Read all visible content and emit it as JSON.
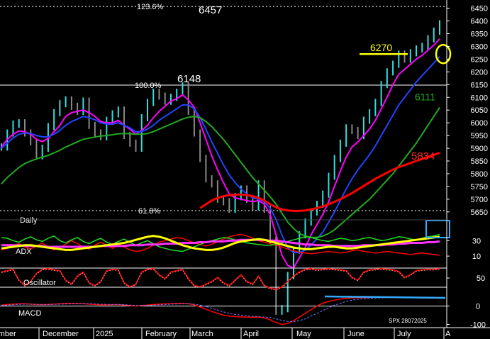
{
  "chart_data": {
    "type": "line",
    "symbol_code": "SPX 28072025",
    "timeframe_label": "Daily",
    "months": [
      "November",
      "December",
      "2025",
      "February",
      "March",
      "April",
      "May",
      "June",
      "July",
      "A"
    ],
    "price_panel": {
      "ylim": [
        5630,
        6460
      ],
      "y_ticks": [
        5650,
        5700,
        5750,
        5800,
        5850,
        5900,
        5950,
        6000,
        6050,
        6100,
        6150,
        6200,
        6250,
        6300,
        6350,
        6400,
        6450
      ],
      "annotations": [
        {
          "label": "6457",
          "value": 6457,
          "color": "#ffffff"
        },
        {
          "label": "6148",
          "value": 6148,
          "color": "#ffffff"
        },
        {
          "label": "6270",
          "value": 6270,
          "color": "#ffff00"
        },
        {
          "label": "6111",
          "value": 6111,
          "color": "#22aa22"
        },
        {
          "label": "5834",
          "value": 5834,
          "color": "#ff2222"
        }
      ],
      "fib_levels": [
        {
          "label": "123.6%",
          "value": 6457
        },
        {
          "label": "100.0%",
          "value": 6148
        },
        {
          "label": "61.8%",
          "value": 5655
        }
      ],
      "close": [
        5905,
        5960,
        5995,
        6000,
        5960,
        5925,
        5870,
        5900,
        5985,
        6040,
        6075,
        6090,
        6065,
        6045,
        6085,
        5990,
        5960,
        5945,
        6010,
        6035,
        6050,
        5950,
        5920,
        5900,
        6020,
        6080,
        6120,
        6105,
        6085,
        6100,
        6120,
        6145,
        6045,
        5960,
        5860,
        5780,
        5760,
        5700,
        5690,
        5660,
        5710,
        5740,
        5700,
        5670,
        5760,
        5660,
        5540,
        5260,
        5270,
        5400,
        5500,
        5560,
        5610,
        5650,
        5680,
        5720,
        5790,
        5860,
        5920,
        5980,
        5970,
        5950,
        6010,
        6040,
        6080,
        6150,
        6200,
        6230,
        6270,
        6250,
        6275,
        6290,
        6300,
        6330,
        6360,
        6389
      ],
      "series": [
        {
          "name": "",
          "color": "#ff00ff",
          "values": [
            5905,
            5935,
            5955,
            5968,
            5965,
            5955,
            5935,
            5926,
            5938,
            5965,
            5990,
            6025,
            6040,
            6045,
            6050,
            6040,
            6025,
            6005,
            6000,
            6000,
            6010,
            5990,
            5975,
            5955,
            5970,
            5990,
            6020,
            6045,
            6065,
            6085,
            6095,
            6110,
            6090,
            6060,
            6000,
            5935,
            5870,
            5815,
            5765,
            5720,
            5705,
            5700,
            5695,
            5690,
            5695,
            5680,
            5640,
            5560,
            5480,
            5440,
            5430,
            5470,
            5510,
            5560,
            5600,
            5640,
            5690,
            5750,
            5810,
            5865,
            5905,
            5925,
            5950,
            5975,
            6010,
            6055,
            6100,
            6150,
            6190,
            6210,
            6230,
            6250,
            6265,
            6285,
            6305,
            6330
          ]
        },
        {
          "name": "",
          "color": "#2244ff",
          "values": [
            5900,
            5920,
            5940,
            5955,
            5960,
            5958,
            5950,
            5945,
            5945,
            5955,
            5970,
            5990,
            6005,
            6015,
            6025,
            6020,
            6012,
            6000,
            5995,
            5995,
            6000,
            5990,
            5980,
            5965,
            5965,
            5975,
            5990,
            6010,
            6025,
            6040,
            6055,
            6070,
            6070,
            6055,
            6020,
            5975,
            5925,
            5880,
            5835,
            5795,
            5765,
            5740,
            5720,
            5705,
            5700,
            5690,
            5665,
            5620,
            5560,
            5510,
            5490,
            5490,
            5500,
            5520,
            5545,
            5570,
            5610,
            5650,
            5695,
            5740,
            5780,
            5815,
            5845,
            5875,
            5910,
            5950,
            5990,
            6030,
            6070,
            6100,
            6130,
            6160,
            6185,
            6210,
            6235,
            6260
          ]
        },
        {
          "name": "",
          "color": "#22aa22",
          "values": [
            5760,
            5785,
            5805,
            5825,
            5840,
            5850,
            5858,
            5865,
            5872,
            5882,
            5892,
            5905,
            5915,
            5925,
            5935,
            5940,
            5944,
            5948,
            5950,
            5953,
            5957,
            5958,
            5957,
            5955,
            5955,
            5958,
            5965,
            5975,
            5985,
            5995,
            6005,
            6015,
            6022,
            6025,
            6020,
            6005,
            5985,
            5960,
            5935,
            5905,
            5875,
            5845,
            5815,
            5785,
            5760,
            5735,
            5710,
            5680,
            5645,
            5610,
            5585,
            5565,
            5555,
            5550,
            5550,
            5555,
            5565,
            5580,
            5600,
            5620,
            5640,
            5660,
            5680,
            5700,
            5725,
            5750,
            5775,
            5800,
            5830,
            5860,
            5890,
            5920,
            5955,
            5990,
            6025,
            6060
          ]
        },
        {
          "name": "",
          "color": "#ff0000",
          "values": [
            null,
            null,
            null,
            null,
            null,
            null,
            null,
            null,
            null,
            null,
            null,
            null,
            null,
            null,
            null,
            null,
            null,
            null,
            null,
            null,
            null,
            null,
            null,
            null,
            null,
            null,
            null,
            null,
            null,
            null,
            null,
            null,
            null,
            null,
            5665,
            5680,
            5695,
            5705,
            5712,
            5716,
            5718,
            5718,
            5716,
            5712,
            5705,
            5695,
            5680,
            5668,
            5660,
            5656,
            5654,
            5654,
            5656,
            5660,
            5665,
            5672,
            5680,
            5690,
            5700,
            5712,
            5724,
            5738,
            5752,
            5766,
            5780,
            5792,
            5804,
            5816,
            5826,
            5834,
            5842,
            5850,
            5858,
            5866,
            5874,
            5882
          ]
        }
      ]
    },
    "adx_panel": {
      "label": "ADX",
      "ylim": [
        0,
        55
      ],
      "y_ticks": [
        10,
        30
      ],
      "series": [
        {
          "name": "",
          "color": "#ffff00",
          "values": [
            20,
            21,
            22,
            23,
            24,
            24,
            23,
            22,
            21,
            20,
            19,
            18,
            18,
            19,
            20,
            21,
            22,
            23,
            24,
            25,
            26,
            27,
            29,
            31,
            33,
            35,
            36,
            35,
            33,
            30,
            27,
            24,
            22,
            20,
            19,
            18,
            18,
            19,
            21,
            24,
            27,
            29,
            30,
            31,
            32,
            31,
            29,
            27,
            25,
            23,
            21,
            20,
            19,
            19,
            20,
            21,
            22,
            22,
            21,
            20,
            20,
            21,
            22,
            23,
            24,
            25,
            26,
            27,
            28,
            29,
            30,
            31,
            32,
            33,
            34,
            35
          ]
        },
        {
          "name": "",
          "color": "#ff33ff",
          "values": [
            24,
            24,
            24,
            24,
            23,
            23,
            23,
            23,
            22,
            22,
            22,
            22,
            22,
            22,
            22,
            22,
            22,
            23,
            23,
            23,
            23,
            23,
            24,
            24,
            24,
            25,
            25,
            25,
            26,
            26,
            26,
            27,
            27,
            27,
            28,
            28,
            29,
            29,
            29,
            30,
            30,
            31,
            31,
            31,
            31,
            31,
            30,
            30,
            29,
            28,
            27,
            26,
            25,
            25,
            24,
            24,
            24,
            23,
            23,
            23,
            23,
            23,
            24,
            24,
            24,
            24,
            25,
            25,
            26,
            26,
            27,
            27,
            27,
            28,
            28,
            29
          ]
        },
        {
          "name": "",
          "color": "#22dd22",
          "values": [
            34,
            33,
            30,
            28,
            32,
            35,
            31,
            29,
            33,
            36,
            30,
            27,
            31,
            34,
            29,
            26,
            30,
            33,
            28,
            25,
            29,
            32,
            28,
            24,
            27,
            30,
            26,
            22,
            20,
            18,
            17,
            16,
            19,
            22,
            25,
            28,
            30,
            32,
            34,
            33,
            31,
            29,
            27,
            26,
            25,
            24,
            24,
            25,
            27,
            29,
            31,
            33,
            35,
            34,
            32,
            30,
            29,
            31,
            33,
            32,
            30,
            31,
            33,
            34,
            32,
            30,
            31,
            33,
            35,
            34,
            32,
            31,
            33,
            35,
            36,
            38
          ]
        },
        {
          "name": "",
          "color": "#ff0000",
          "values": [
            18,
            20,
            24,
            26,
            22,
            19,
            23,
            27,
            22,
            18,
            21,
            25,
            30,
            26,
            22,
            19,
            24,
            28,
            24,
            20,
            25,
            22,
            18,
            16,
            17,
            20,
            24,
            28,
            30,
            32,
            34,
            33,
            30,
            27,
            25,
            23,
            25,
            29,
            32,
            35,
            37,
            38,
            36,
            33,
            30,
            28,
            26,
            24,
            22,
            19,
            17,
            15,
            14,
            13,
            14,
            15,
            16,
            15,
            14,
            15,
            17,
            18,
            16,
            15,
            14,
            15,
            16,
            15,
            14,
            13,
            12,
            13,
            14,
            13,
            12,
            11
          ]
        }
      ]
    },
    "oscillator_panel": {
      "label": "Oscillator",
      "ylim": [
        0,
        100
      ],
      "y_ticks": [
        50
      ],
      "series": [
        {
          "name": "",
          "color": "#ff0000",
          "values": [
            70,
            75,
            80,
            40,
            20,
            35,
            65,
            80,
            82,
            78,
            75,
            40,
            25,
            55,
            70,
            30,
            20,
            35,
            75,
            80,
            78,
            30,
            15,
            25,
            70,
            80,
            82,
            60,
            45,
            70,
            75,
            80,
            45,
            20,
            15,
            25,
            35,
            50,
            30,
            20,
            40,
            60,
            35,
            25,
            55,
            20,
            10,
            5,
            15,
            35,
            55,
            70,
            80,
            82,
            78,
            80,
            82,
            80,
            78,
            75,
            50,
            40,
            70,
            78,
            80,
            82,
            80,
            78,
            72,
            50,
            60,
            75,
            78,
            80,
            80,
            82
          ]
        }
      ]
    },
    "macd_panel": {
      "label": "MACD",
      "ylim": [
        -110,
        75
      ],
      "y_ticks": [
        0,
        -100
      ],
      "series": [
        {
          "name": "",
          "color": "#ff0000",
          "values": [
            5,
            8,
            10,
            12,
            12,
            10,
            8,
            7,
            8,
            10,
            12,
            14,
            15,
            14,
            13,
            10,
            8,
            6,
            6,
            7,
            8,
            5,
            2,
            0,
            2,
            5,
            8,
            10,
            12,
            13,
            14,
            15,
            12,
            6,
            -5,
            -18,
            -30,
            -40,
            -50,
            -55,
            -58,
            -60,
            -60,
            -62,
            -60,
            -65,
            -75,
            -90,
            -100,
            -95,
            -80,
            -60,
            -40,
            -20,
            0,
            15,
            25,
            32,
            38,
            42,
            44,
            45,
            45,
            46,
            47,
            48,
            49,
            48,
            47,
            46,
            45,
            45,
            44,
            44,
            44,
            45
          ]
        },
        {
          "name": "",
          "color": "#7777ff",
          "values": [
            3,
            5,
            7,
            9,
            10,
            10,
            9,
            8,
            8,
            9,
            10,
            11,
            12,
            13,
            13,
            12,
            11,
            10,
            9,
            8,
            8,
            7,
            5,
            3,
            3,
            3,
            4,
            6,
            8,
            10,
            11,
            12,
            12,
            10,
            5,
            -3,
            -12,
            -22,
            -32,
            -40,
            -46,
            -50,
            -54,
            -56,
            -58,
            -60,
            -63,
            -70,
            -78,
            -84,
            -85,
            -80,
            -70,
            -55,
            -40,
            -25,
            -10,
            5,
            15,
            25,
            32,
            36,
            39,
            41,
            43,
            44,
            45,
            46,
            46,
            46,
            45,
            45,
            45,
            44,
            44,
            44
          ]
        }
      ],
      "highlight_line": {
        "color": "#33aaff",
        "value": 52
      }
    }
  }
}
